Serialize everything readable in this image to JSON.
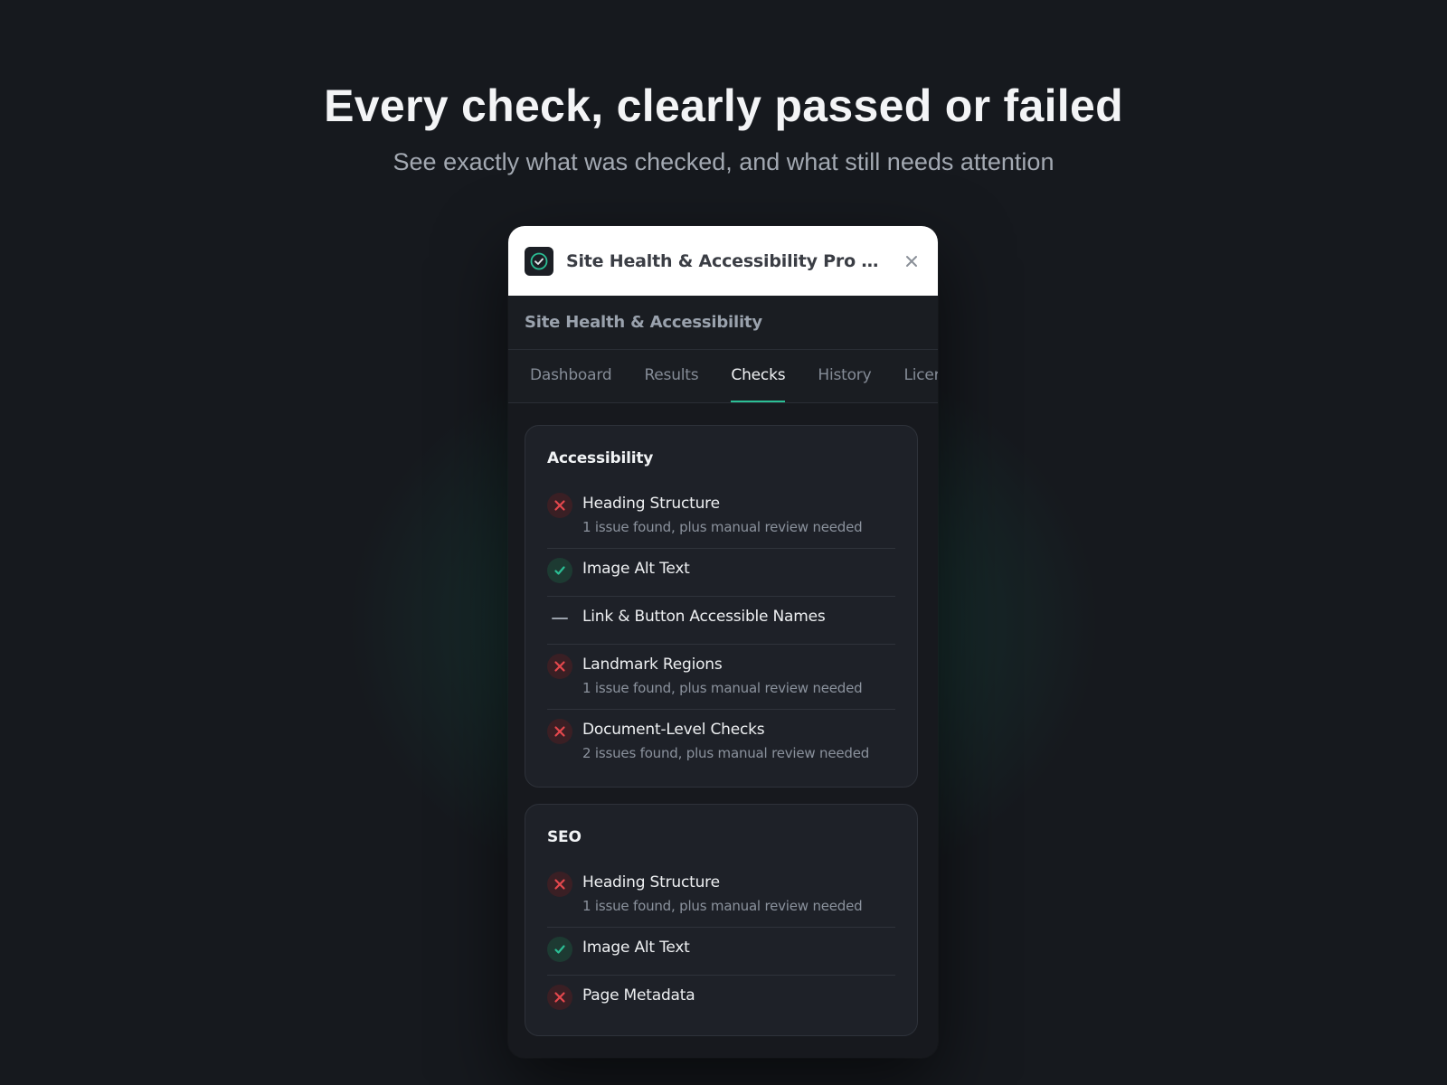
{
  "hero": {
    "title": "Every check, clearly passed or failed",
    "subtitle": "See exactly what was checked, and what still needs attention"
  },
  "window": {
    "title": "Site Health & Accessibility Pro (Devel...",
    "app_icon": "check-circle-icon",
    "close_icon": "close-icon"
  },
  "header": {
    "title": "Site Health & Accessibility"
  },
  "tabs": [
    {
      "label": "Dashboard",
      "active": false
    },
    {
      "label": "Results",
      "active": false
    },
    {
      "label": "Checks",
      "active": true
    },
    {
      "label": "History",
      "active": false
    },
    {
      "label": "Licer",
      "active": false
    }
  ],
  "colors": {
    "accent": "#2bbf95",
    "fail": "#e5484d",
    "pass": "#2bbf95"
  },
  "sections": [
    {
      "title": "Accessibility",
      "items": [
        {
          "status": "fail",
          "title": "Heading Structure",
          "detail": "1 issue found, plus manual review needed"
        },
        {
          "status": "pass",
          "title": "Image Alt Text",
          "detail": ""
        },
        {
          "status": "na",
          "title": "Link & Button Accessible Names",
          "detail": ""
        },
        {
          "status": "fail",
          "title": "Landmark Regions",
          "detail": "1 issue found, plus manual review needed"
        },
        {
          "status": "fail",
          "title": "Document-Level Checks",
          "detail": "2 issues found, plus manual review needed"
        }
      ]
    },
    {
      "title": "SEO",
      "items": [
        {
          "status": "fail",
          "title": "Heading Structure",
          "detail": "1 issue found, plus manual review needed"
        },
        {
          "status": "pass",
          "title": "Image Alt Text",
          "detail": ""
        },
        {
          "status": "fail",
          "title": "Page Metadata",
          "detail": ""
        }
      ]
    }
  ]
}
